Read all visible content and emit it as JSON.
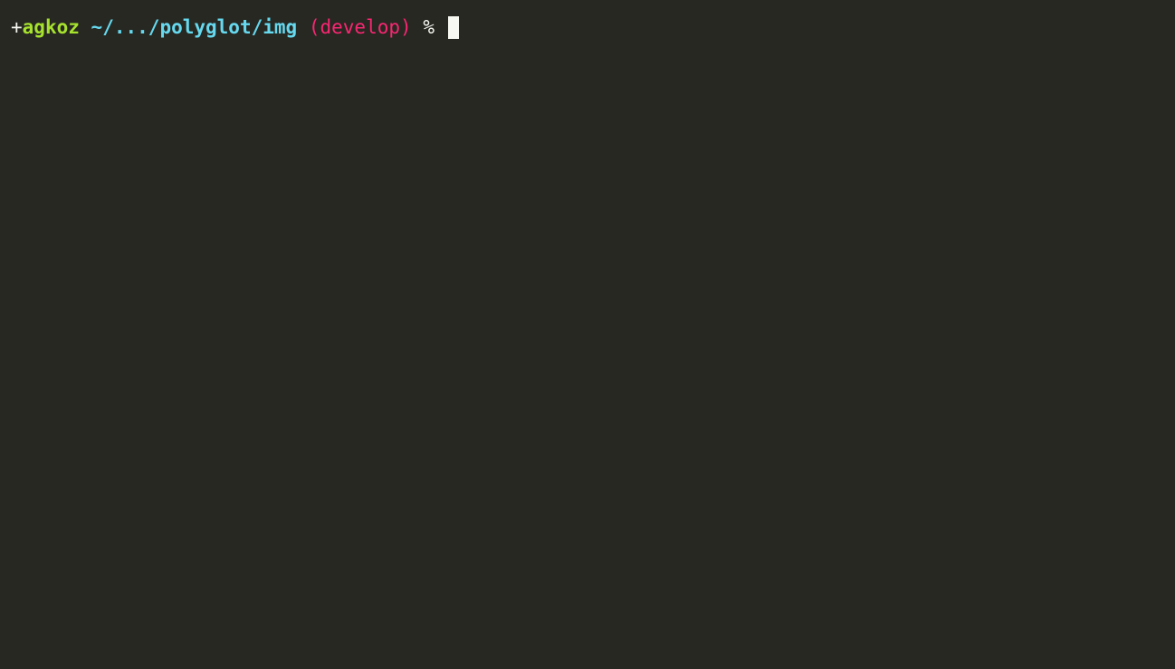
{
  "prompt": {
    "plus": "+",
    "user": "agkoz",
    "space1": " ",
    "path_tilde": "~",
    "path_slash1": "/",
    "path_dots": "...",
    "path_slash2": "/",
    "path_seg1": "polyglot",
    "path_slash3": "/",
    "path_seg2": "img",
    "space2": " ",
    "paren_open": "(",
    "branch": "develop",
    "paren_close": ")",
    "space3": " ",
    "percent": "%",
    "space4": " "
  }
}
